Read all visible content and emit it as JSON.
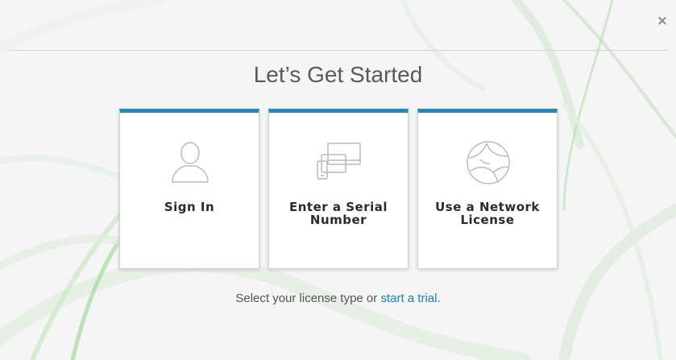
{
  "dialog": {
    "close_label": "×",
    "title": "Let’s Get Started"
  },
  "cards": [
    {
      "label": "Sign In",
      "icon": "user-silhouette-icon"
    },
    {
      "label": "Enter a Serial\nNumber",
      "icon": "devices-icon"
    },
    {
      "label": "Use a Network\nLicense",
      "icon": "network-globe-icon"
    }
  ],
  "footer": {
    "prefix": "Select your license type or ",
    "link": "start a trial",
    "suffix": "."
  },
  "colors": {
    "accent": "#1d8ac5",
    "link": "#1d7fbf",
    "title": "#5a5a5a",
    "background": "#f4f5f4"
  }
}
